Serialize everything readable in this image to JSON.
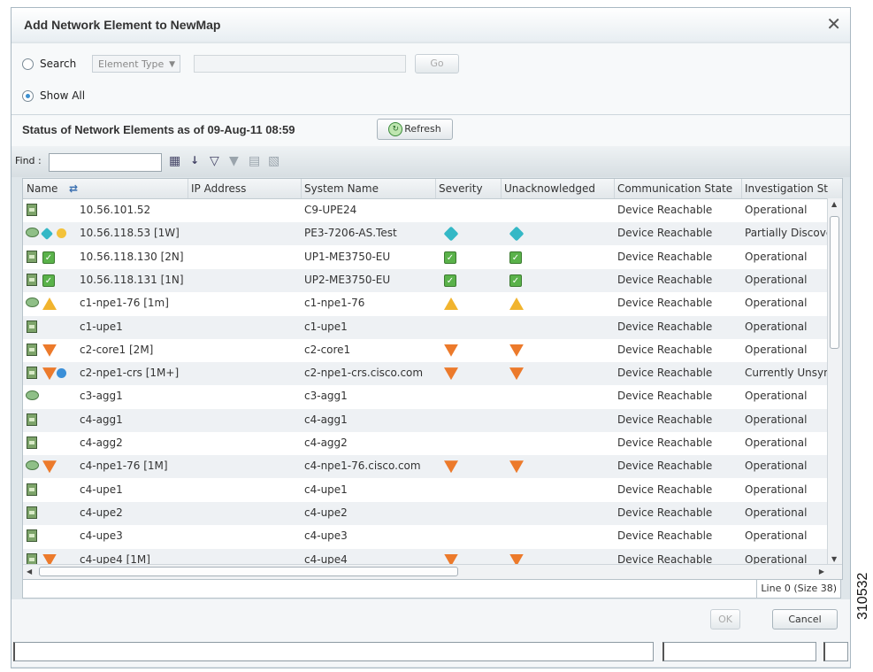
{
  "dialog": {
    "title": "Add Network Element to NewMap"
  },
  "search": {
    "search_label": "Search",
    "element_type_label": "Element Type",
    "go_label": "Go",
    "show_all_label": "Show All",
    "selected": "Show All"
  },
  "status": {
    "title": "Status of Network Elements as of 09-Aug-11 08:59",
    "refresh_label": "Refresh"
  },
  "find": {
    "label": "Find :",
    "value": ""
  },
  "columns": [
    "Name",
    "IP Address",
    "System Name",
    "Severity",
    "Unacknowledged",
    "Communication State",
    "Investigation St"
  ],
  "rows": [
    {
      "name": "10.56.101.52",
      "type": "device",
      "badges": [],
      "system": "C9-UPE24",
      "severity": "",
      "unack": "",
      "comm": "Device Reachable",
      "inv": "Operational"
    },
    {
      "name": "10.56.118.53 [1W]",
      "type": "router",
      "badges": [
        "info",
        "warning-circle"
      ],
      "system": "PE3-7206-AS.Test",
      "severity": "info",
      "unack": "info",
      "comm": "Device Reachable",
      "inv": "Partially Discove"
    },
    {
      "name": "10.56.118.130 [2N]",
      "type": "device",
      "badges": [
        "ok"
      ],
      "system": "UP1-ME3750-EU",
      "severity": "ok",
      "unack": "ok",
      "comm": "Device Reachable",
      "inv": "Operational"
    },
    {
      "name": "10.56.118.131 [1N]",
      "type": "device",
      "badges": [
        "ok"
      ],
      "system": "UP2-ME3750-EU",
      "severity": "ok",
      "unack": "ok",
      "comm": "Device Reachable",
      "inv": "Operational"
    },
    {
      "name": "c1-npe1-76 [1m]",
      "type": "router",
      "badges": [
        "warning"
      ],
      "system": "c1-npe1-76",
      "severity": "warning",
      "unack": "warning",
      "comm": "Device Reachable",
      "inv": "Operational"
    },
    {
      "name": "c1-upe1",
      "type": "device",
      "badges": [],
      "system": "c1-upe1",
      "severity": "",
      "unack": "",
      "comm": "Device Reachable",
      "inv": "Operational"
    },
    {
      "name": "c2-core1 [2M]",
      "type": "switch",
      "badges": [
        "major"
      ],
      "system": "c2-core1",
      "severity": "major",
      "unack": "major",
      "comm": "Device Reachable",
      "inv": "Operational"
    },
    {
      "name": "c2-npe1-crs [1M+]",
      "type": "device",
      "badges": [
        "major",
        "info-circle"
      ],
      "system": "c2-npe1-crs.cisco.com",
      "severity": "major",
      "unack": "major",
      "comm": "Device Reachable",
      "inv": "Currently Unsyn"
    },
    {
      "name": "c3-agg1",
      "type": "router",
      "badges": [],
      "system": "c3-agg1",
      "severity": "",
      "unack": "",
      "comm": "Device Reachable",
      "inv": "Operational"
    },
    {
      "name": "c4-agg1",
      "type": "device",
      "badges": [],
      "system": "c4-agg1",
      "severity": "",
      "unack": "",
      "comm": "Device Reachable",
      "inv": "Operational"
    },
    {
      "name": "c4-agg2",
      "type": "device",
      "badges": [],
      "system": "c4-agg2",
      "severity": "",
      "unack": "",
      "comm": "Device Reachable",
      "inv": "Operational"
    },
    {
      "name": "c4-npe1-76 [1M]",
      "type": "router",
      "badges": [
        "major"
      ],
      "system": "c4-npe1-76.cisco.com",
      "severity": "major",
      "unack": "major",
      "comm": "Device Reachable",
      "inv": "Operational"
    },
    {
      "name": "c4-upe1",
      "type": "device",
      "badges": [],
      "system": "c4-upe1",
      "severity": "",
      "unack": "",
      "comm": "Device Reachable",
      "inv": "Operational"
    },
    {
      "name": "c4-upe2",
      "type": "device",
      "badges": [],
      "system": "c4-upe2",
      "severity": "",
      "unack": "",
      "comm": "Device Reachable",
      "inv": "Operational"
    },
    {
      "name": "c4-upe3",
      "type": "device",
      "badges": [],
      "system": "c4-upe3",
      "severity": "",
      "unack": "",
      "comm": "Device Reachable",
      "inv": "Operational"
    },
    {
      "name": "c4-upe4 [1M]",
      "type": "device",
      "badges": [
        "major"
      ],
      "system": "c4-upe4",
      "severity": "major",
      "unack": "major",
      "comm": "Device Reachable",
      "inv": "Operational"
    }
  ],
  "line_info": "Line 0 (Size 38)",
  "buttons": {
    "ok": "OK",
    "cancel": "Cancel"
  },
  "figure_id": "310532"
}
